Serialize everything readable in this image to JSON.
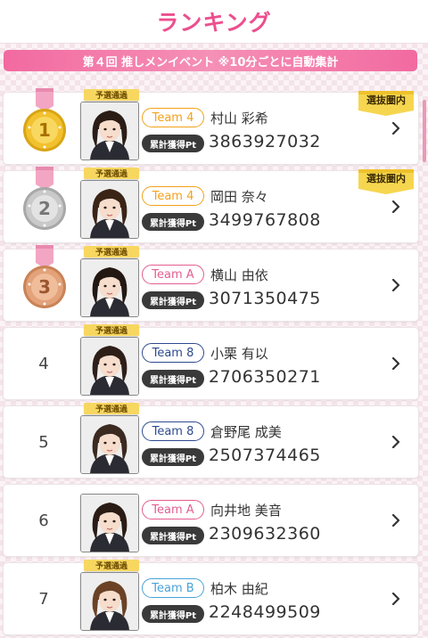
{
  "header": {
    "title": "ランキング"
  },
  "banner": {
    "text": "第４回 推しメンイベント ※10分ごとに自動集計"
  },
  "labels": {
    "pt_label": "累計獲得Pt",
    "yosen": "予選通過",
    "senbatsu": "選抜圏内"
  },
  "colors": {
    "team_4": "#f2a21a",
    "team_A": "#e45d8f",
    "team_8": "#2d4a8f",
    "team_B": "#4aa3d8"
  },
  "rankings": [
    {
      "rank": "1",
      "medal": "gold",
      "team": "Team 4",
      "name": "村山 彩希",
      "points": "3863927032",
      "yosen": true,
      "senbatsu": true
    },
    {
      "rank": "2",
      "medal": "silver",
      "team": "Team 4",
      "name": "岡田 奈々",
      "points": "3499767808",
      "yosen": true,
      "senbatsu": true
    },
    {
      "rank": "3",
      "medal": "bronze",
      "team": "Team A",
      "name": "横山 由依",
      "points": "3071350475",
      "yosen": true,
      "senbatsu": false
    },
    {
      "rank": "4",
      "medal": "",
      "team": "Team 8",
      "name": "小栗 有以",
      "points": "2706350271",
      "yosen": true,
      "senbatsu": false
    },
    {
      "rank": "5",
      "medal": "",
      "team": "Team 8",
      "name": "倉野尾 成美",
      "points": "2507374465",
      "yosen": true,
      "senbatsu": false
    },
    {
      "rank": "6",
      "medal": "",
      "team": "Team A",
      "name": "向井地 美音",
      "points": "2309632360",
      "yosen": false,
      "senbatsu": false
    },
    {
      "rank": "7",
      "medal": "",
      "team": "Team B",
      "name": "柏木 由紀",
      "points": "2248499509",
      "yosen": true,
      "senbatsu": false
    }
  ]
}
